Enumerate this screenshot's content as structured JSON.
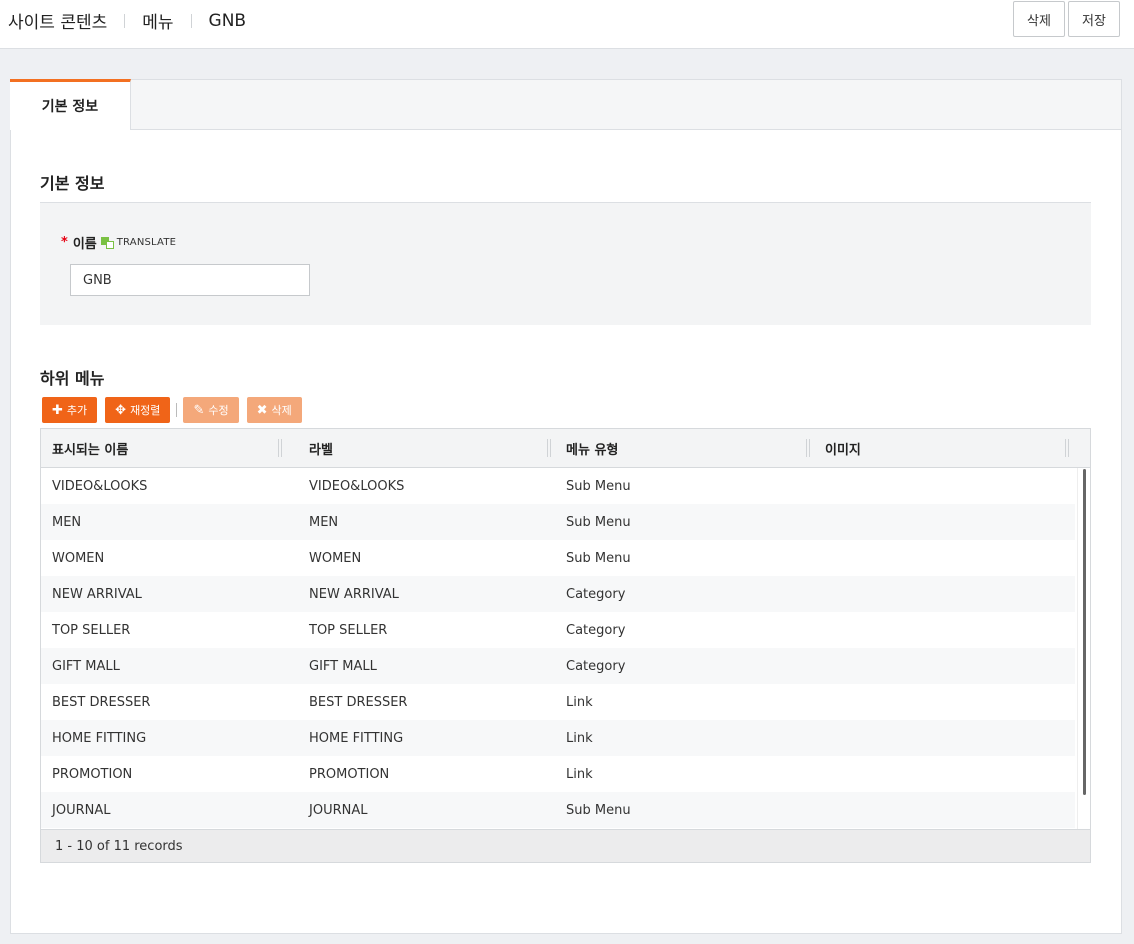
{
  "breadcrumb": [
    "사이트 콘텐츠",
    "메뉴",
    "GNB"
  ],
  "top_actions": {
    "delete_label": "삭제",
    "save_label": "저장"
  },
  "tab": {
    "label": "기본 정보"
  },
  "basic_info": {
    "title": "기본 정보",
    "name_field": {
      "required_mark": "*",
      "label": "이름",
      "translate_label": "TRANSLATE",
      "value": "GNB"
    }
  },
  "submenu": {
    "title": "하위 메뉴",
    "toolbar": {
      "add": "추가",
      "reorder": "재정렬",
      "edit": "수정",
      "delete": "삭제"
    },
    "columns": [
      "표시되는 이름",
      "라벨",
      "메뉴 유형",
      "이미지"
    ],
    "rows": [
      [
        "VIDEO&LOOKS",
        "VIDEO&LOOKS",
        "Sub Menu",
        ""
      ],
      [
        "MEN",
        "MEN",
        "Sub Menu",
        ""
      ],
      [
        "WOMEN",
        "WOMEN",
        "Sub Menu",
        ""
      ],
      [
        "NEW ARRIVAL",
        "NEW ARRIVAL",
        "Category",
        ""
      ],
      [
        "TOP SELLER",
        "TOP SELLER",
        "Category",
        ""
      ],
      [
        "GIFT MALL",
        "GIFT MALL",
        "Category",
        ""
      ],
      [
        "BEST DRESSER",
        "BEST DRESSER",
        "Link",
        ""
      ],
      [
        "HOME FITTING",
        "HOME FITTING",
        "Link",
        ""
      ],
      [
        "PROMOTION",
        "PROMOTION",
        "Link",
        ""
      ],
      [
        "JOURNAL",
        "JOURNAL",
        "Sub Menu",
        ""
      ]
    ],
    "footer": "1 - 10 of 11 records"
  },
  "colors": {
    "accent": "#f06418",
    "accent_disabled": "#f4a87a",
    "tab_highlight": "#f37021",
    "required": "#e60012",
    "translate_icon": "#7ac143"
  }
}
